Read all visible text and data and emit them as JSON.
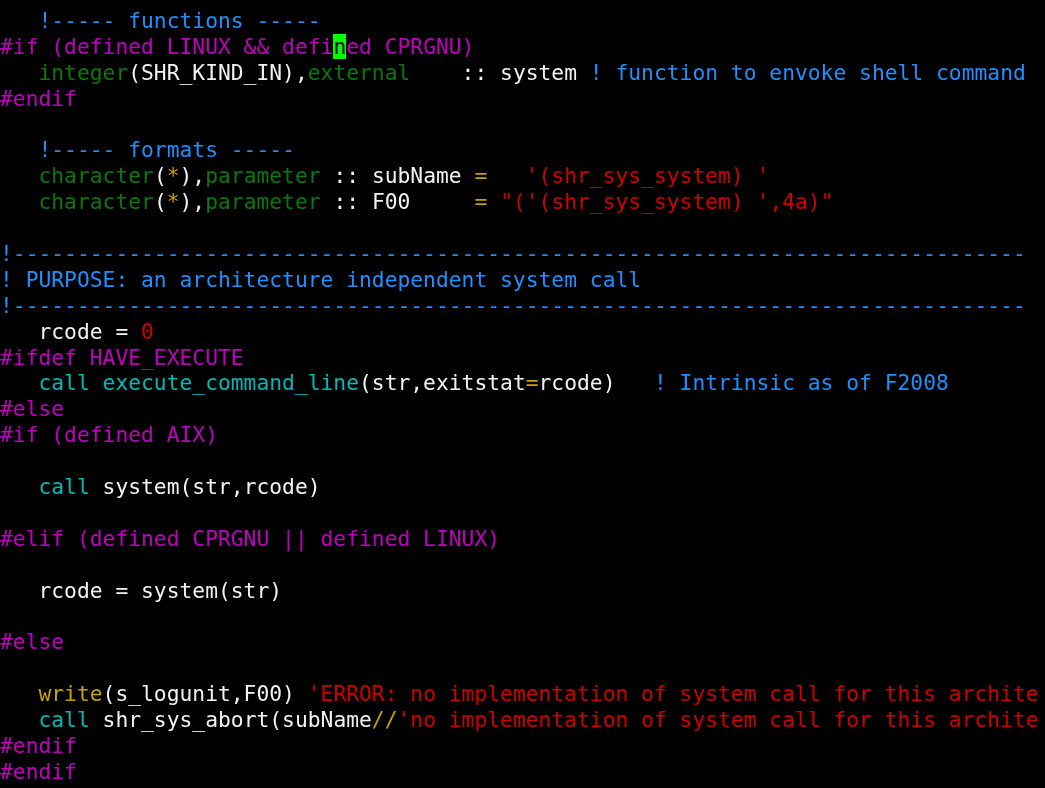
{
  "editor": {
    "lines": [
      {
        "kind": "code",
        "segments": [
          {
            "text": "   !----- functions -----",
            "kind": "comment"
          }
        ]
      },
      {
        "kind": "code",
        "segments": [
          {
            "text": "#if (defined LINUX && defi",
            "kind": "preproc"
          },
          {
            "text": "n",
            "kind": "cursor"
          },
          {
            "text": "ed CPRGNU)",
            "kind": "preproc"
          }
        ]
      },
      {
        "kind": "code",
        "segments": [
          {
            "text": "   integer",
            "kind": "type"
          },
          {
            "text": "(SHR_KIND_IN),",
            "kind": "plain"
          },
          {
            "text": "external",
            "kind": "type"
          },
          {
            "text": "    :: system ",
            "kind": "plain"
          },
          {
            "text": "! function to envoke shell command",
            "kind": "comment"
          }
        ]
      },
      {
        "kind": "code",
        "segments": [
          {
            "text": "#endif",
            "kind": "preproc"
          }
        ]
      },
      {
        "kind": "blank"
      },
      {
        "kind": "code",
        "segments": [
          {
            "text": "   !----- formats -----",
            "kind": "comment"
          }
        ]
      },
      {
        "kind": "code",
        "segments": [
          {
            "text": "   character",
            "kind": "type"
          },
          {
            "text": "(",
            "kind": "plain"
          },
          {
            "text": "*",
            "kind": "operator"
          },
          {
            "text": "),",
            "kind": "plain"
          },
          {
            "text": "parameter",
            "kind": "type"
          },
          {
            "text": " :: subName ",
            "kind": "plain"
          },
          {
            "text": "=   ",
            "kind": "operator"
          },
          {
            "text": "'(shr_sys_system) '",
            "kind": "string"
          }
        ]
      },
      {
        "kind": "code",
        "segments": [
          {
            "text": "   character",
            "kind": "type"
          },
          {
            "text": "(",
            "kind": "plain"
          },
          {
            "text": "*",
            "kind": "operator"
          },
          {
            "text": "),",
            "kind": "plain"
          },
          {
            "text": "parameter",
            "kind": "type"
          },
          {
            "text": " :: F00     ",
            "kind": "plain"
          },
          {
            "text": "= ",
            "kind": "operator"
          },
          {
            "text": "\"('(shr_sys_system) ',4a)\"",
            "kind": "string"
          }
        ]
      },
      {
        "kind": "blank"
      },
      {
        "kind": "code",
        "segments": [
          {
            "text": "!-------------------------------------------------------------------------------",
            "kind": "comment"
          }
        ]
      },
      {
        "kind": "code",
        "segments": [
          {
            "text": "! PURPOSE: an architecture independent system call",
            "kind": "comment"
          }
        ]
      },
      {
        "kind": "code",
        "segments": [
          {
            "text": "!-------------------------------------------------------------------------------",
            "kind": "comment"
          }
        ]
      },
      {
        "kind": "code",
        "segments": [
          {
            "text": "   rcode = ",
            "kind": "plain"
          },
          {
            "text": "0",
            "kind": "number"
          }
        ]
      },
      {
        "kind": "code",
        "segments": [
          {
            "text": "#ifdef HAVE_EXECUTE",
            "kind": "preproc"
          }
        ]
      },
      {
        "kind": "code",
        "segments": [
          {
            "text": "   call execute_command_line",
            "kind": "statement"
          },
          {
            "text": "(str,exitstat",
            "kind": "plain"
          },
          {
            "text": "=",
            "kind": "operator"
          },
          {
            "text": "rcode)   ",
            "kind": "plain"
          },
          {
            "text": "! Intrinsic as of F2008",
            "kind": "comment"
          }
        ]
      },
      {
        "kind": "code",
        "segments": [
          {
            "text": "#else",
            "kind": "preproc"
          }
        ]
      },
      {
        "kind": "code",
        "segments": [
          {
            "text": "#if (defined AIX)",
            "kind": "preproc"
          }
        ]
      },
      {
        "kind": "blank"
      },
      {
        "kind": "code",
        "segments": [
          {
            "text": "   call",
            "kind": "statement"
          },
          {
            "text": " system(str,rcode)",
            "kind": "plain"
          }
        ]
      },
      {
        "kind": "blank"
      },
      {
        "kind": "code",
        "segments": [
          {
            "text": "#elif (defined CPRGNU || defined LINUX)",
            "kind": "preproc"
          }
        ]
      },
      {
        "kind": "blank"
      },
      {
        "kind": "code",
        "segments": [
          {
            "text": "   rcode = system(str)",
            "kind": "plain"
          }
        ]
      },
      {
        "kind": "blank"
      },
      {
        "kind": "code",
        "segments": [
          {
            "text": "#else",
            "kind": "preproc"
          }
        ]
      },
      {
        "kind": "blank"
      },
      {
        "kind": "code",
        "segments": [
          {
            "text": "   write",
            "kind": "operator"
          },
          {
            "text": "(s_logunit,F00) ",
            "kind": "plain"
          },
          {
            "text": "'ERROR: no implementation of system call for this archite",
            "kind": "string"
          }
        ]
      },
      {
        "kind": "code",
        "segments": [
          {
            "text": "   call",
            "kind": "statement"
          },
          {
            "text": " shr_sys_abort(subName",
            "kind": "plain"
          },
          {
            "text": "//",
            "kind": "operator"
          },
          {
            "text": "'no implementation of system call for this archite",
            "kind": "string"
          }
        ]
      },
      {
        "kind": "code",
        "segments": [
          {
            "text": "#endif",
            "kind": "preproc"
          }
        ]
      },
      {
        "kind": "code",
        "segments": [
          {
            "text": "#endif",
            "kind": "preproc"
          }
        ]
      }
    ]
  }
}
